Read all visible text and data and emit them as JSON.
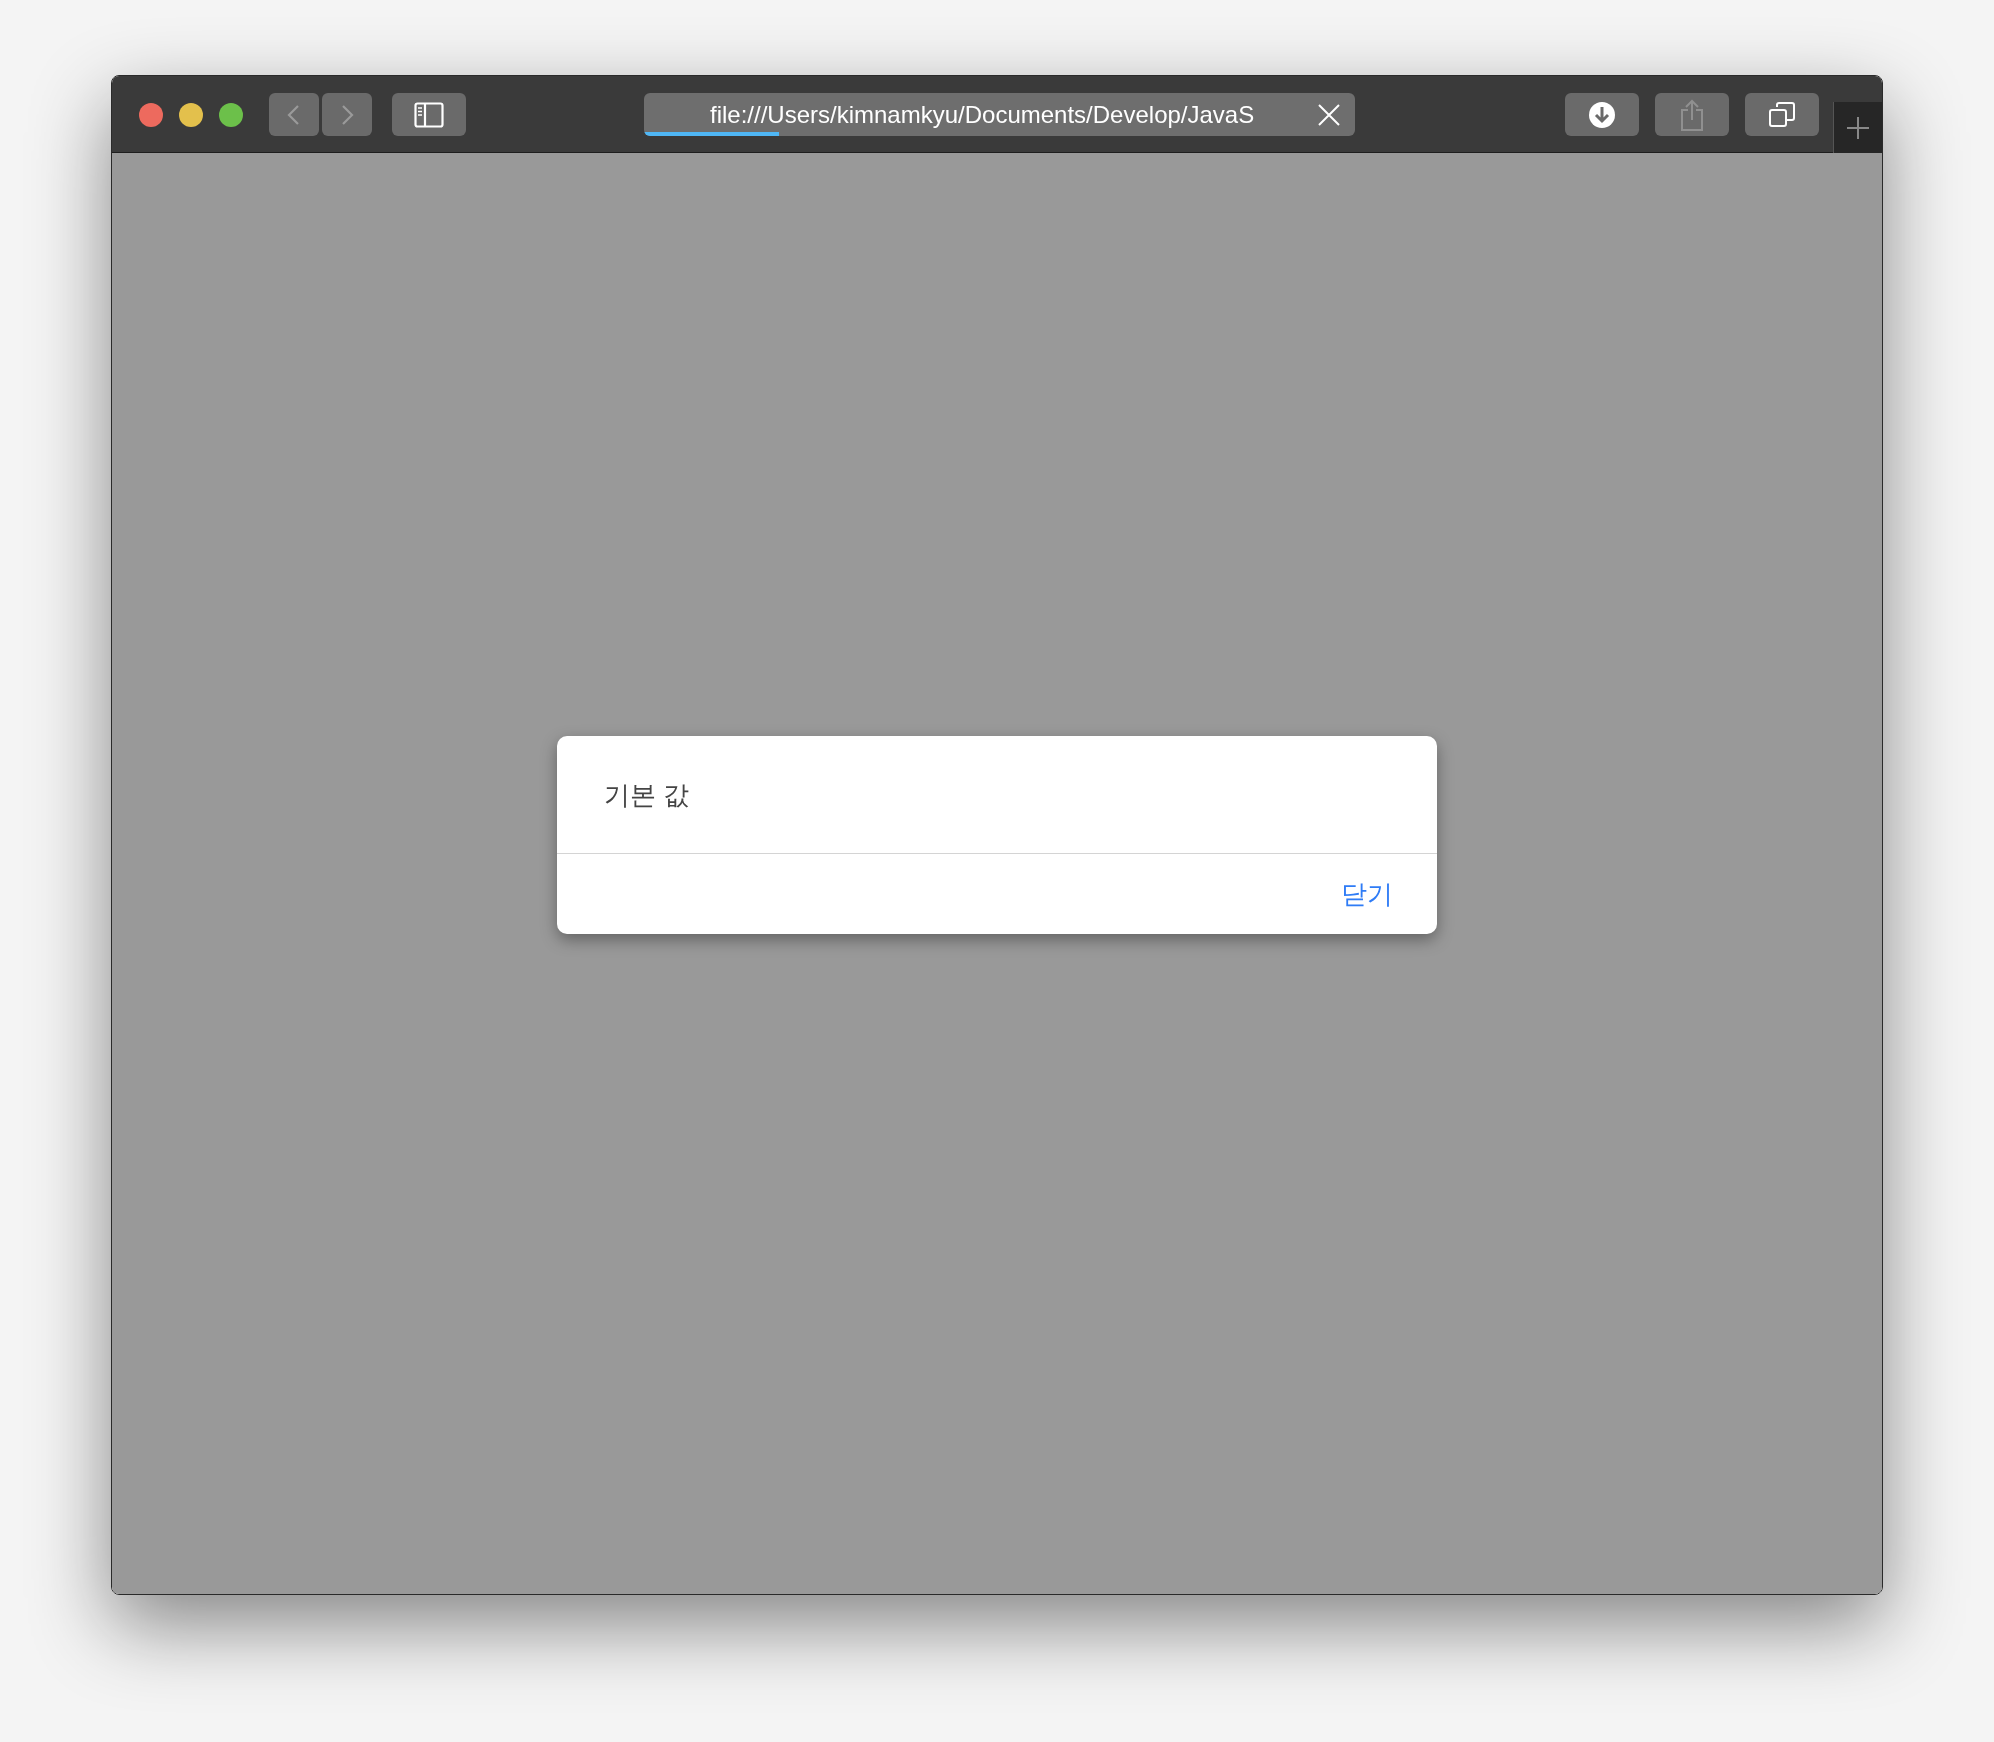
{
  "window": {
    "traffic_lights": [
      {
        "color": "#ed6a5e"
      },
      {
        "color": "#e3c04c"
      },
      {
        "color": "#6cc04a"
      }
    ]
  },
  "nav_buttons": [
    {
      "kind": "back",
      "disabled": true
    },
    {
      "kind": "forward",
      "disabled": true
    }
  ],
  "address_bar": {
    "url": "file:///Users/kimnamkyu/Documents/Develop/JavaS",
    "loading": {
      "level": 0.19
    }
  },
  "toolbar_buttons": [
    {
      "kind": "downloads",
      "disabled": false
    },
    {
      "kind": "share",
      "disabled": true
    },
    {
      "kind": "tabs",
      "disabled": false
    }
  ],
  "dialog": {
    "message": "기본 값",
    "buttons": [
      "닫기"
    ]
  }
}
